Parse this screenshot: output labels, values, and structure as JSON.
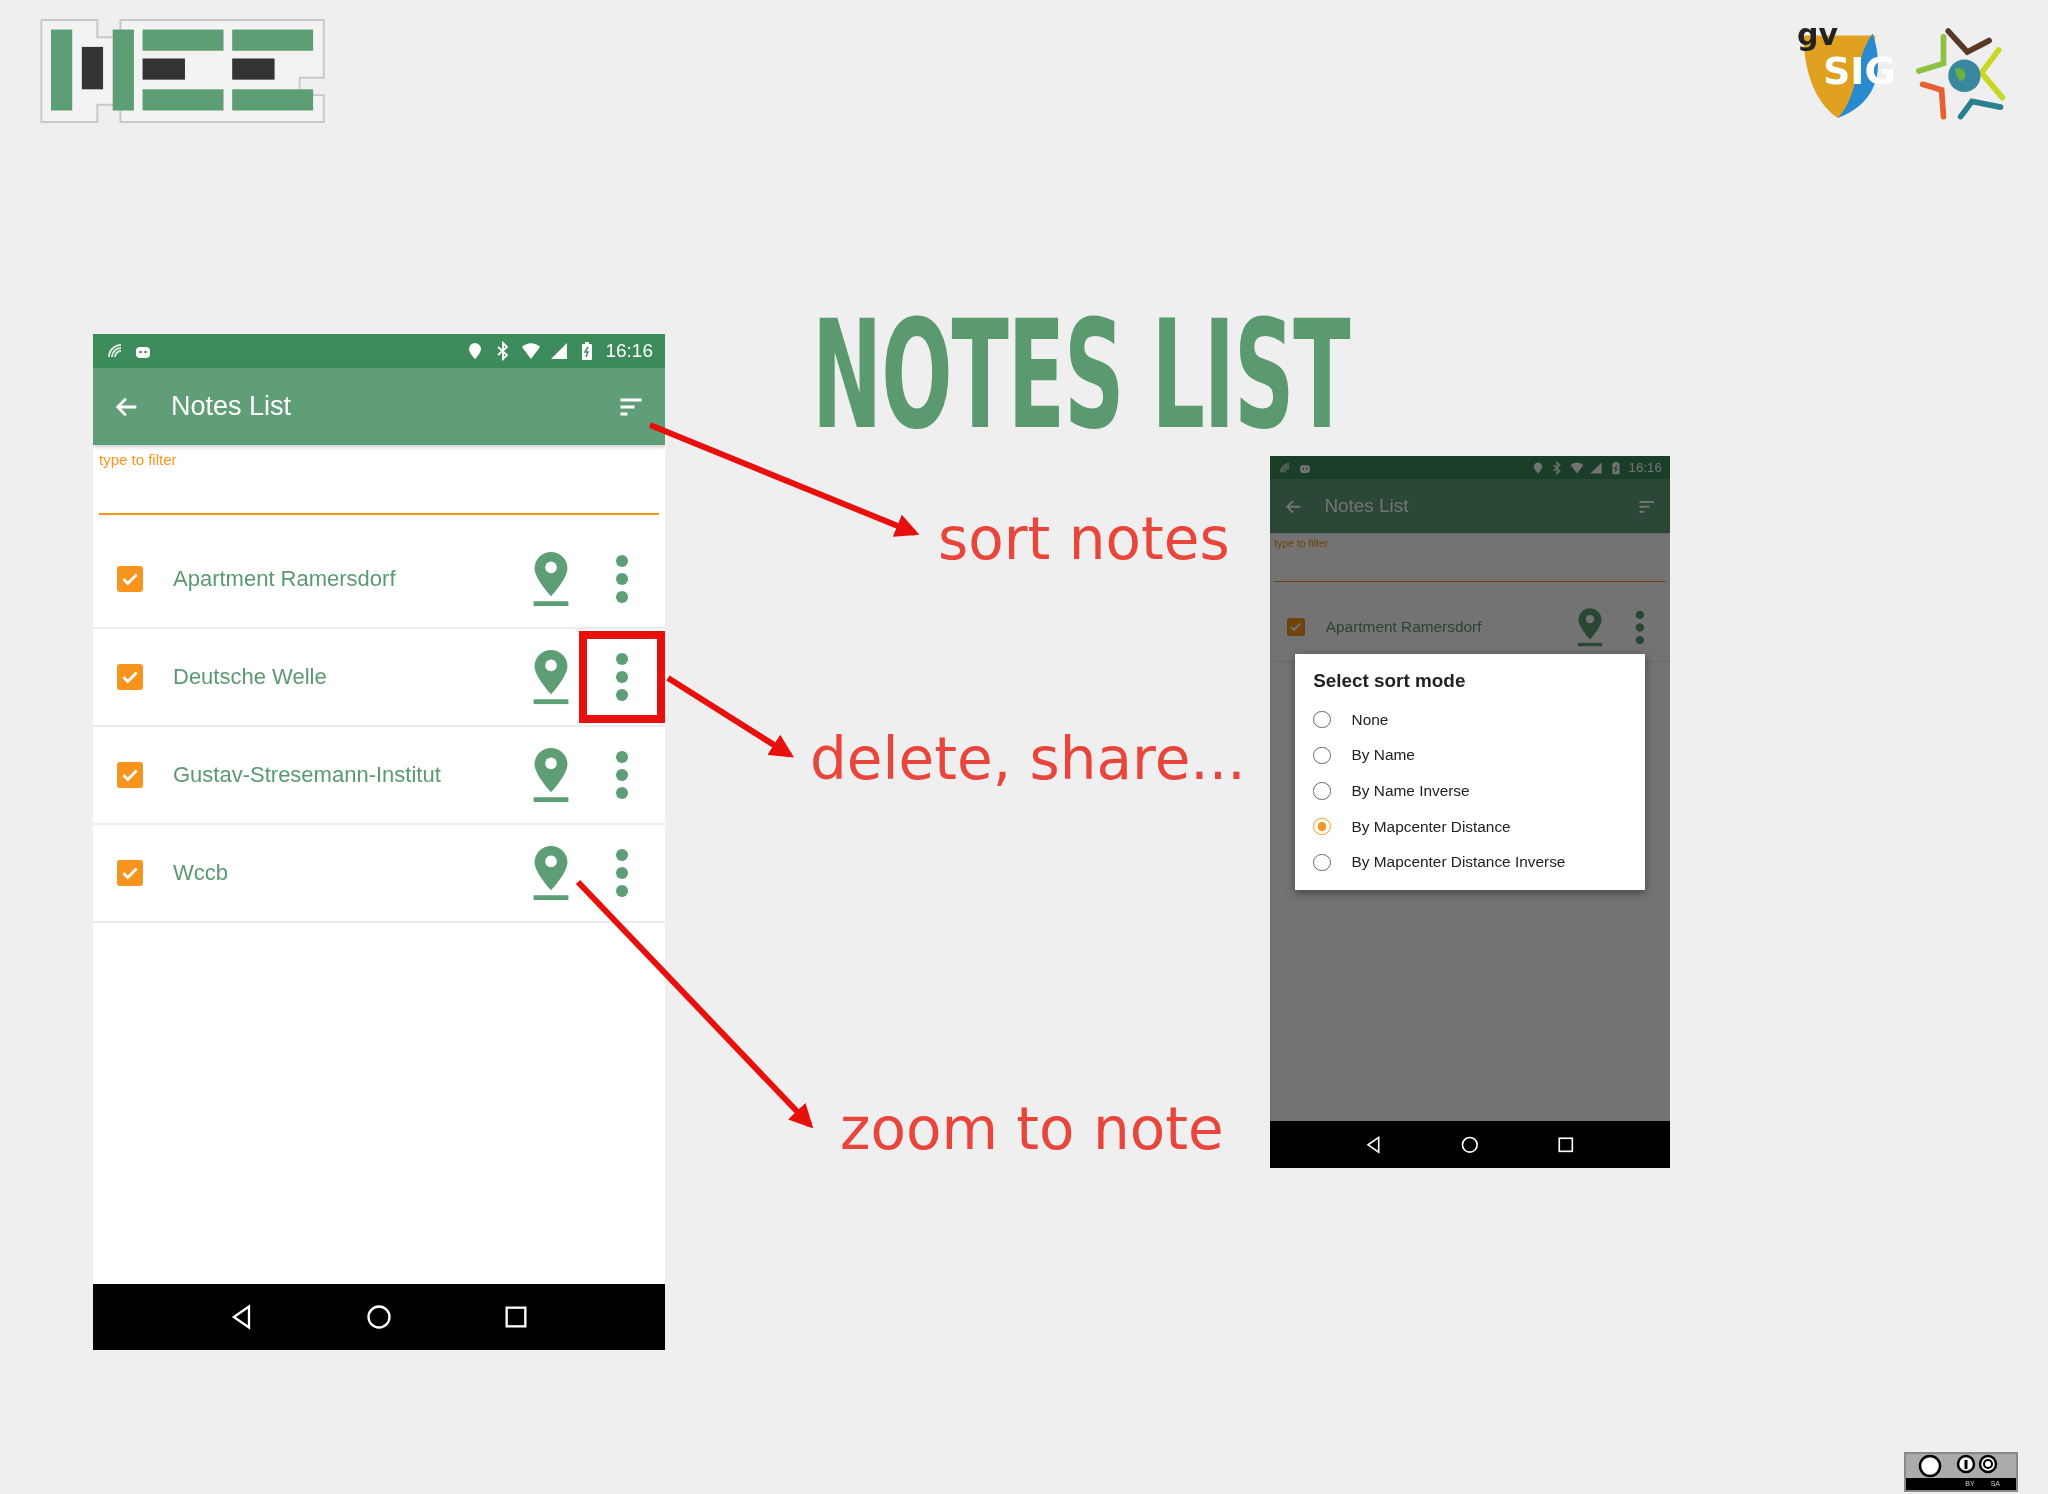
{
  "logos": [
    {
      "kind": "hce"
    },
    {
      "kind": "gvsig",
      "small_text": "gv",
      "big_text": "SIG"
    },
    {
      "kind": "osgeo"
    }
  ],
  "title": "NOTES LIST",
  "phones": [
    {
      "kind": "list",
      "time": "16:16",
      "toolbar_title": "Notes List",
      "filter": {
        "placeholder": "type to filter"
      },
      "dimmed": false,
      "notes": [
        {
          "name": "Apartment Ramersdorf",
          "checked": true,
          "highlighted": false
        },
        {
          "name": "Deutsche Welle",
          "checked": true,
          "highlighted": true
        },
        {
          "name": "Gustav-Stresemann-Institut",
          "checked": true,
          "highlighted": false
        },
        {
          "name": "Wccb",
          "checked": true,
          "highlighted": false
        }
      ]
    },
    {
      "kind": "dialog",
      "time": "16:16",
      "toolbar_title": "Notes List",
      "filter": {
        "placeholder": "type to filter"
      },
      "dimmed": true,
      "notes": [
        {
          "name": "Apartment Ramersdorf",
          "checked": true,
          "highlighted": false
        }
      ],
      "dialog": {
        "title": "Select sort mode",
        "options": [
          {
            "label": "None",
            "selected": false
          },
          {
            "label": "By Name",
            "selected": false
          },
          {
            "label": "By Name Inverse",
            "selected": false
          },
          {
            "label": "By Mapcenter Distance",
            "selected": true
          },
          {
            "label": "By Mapcenter Distance Inverse",
            "selected": false
          }
        ]
      }
    }
  ],
  "annotations": [
    {
      "kind": "sort",
      "text": "sort notes"
    },
    {
      "kind": "menu",
      "text": "delete, share..."
    },
    {
      "kind": "zoom",
      "text": "zoom to note"
    }
  ],
  "license_badge": {
    "labels": [
      "BY",
      "SA"
    ]
  }
}
